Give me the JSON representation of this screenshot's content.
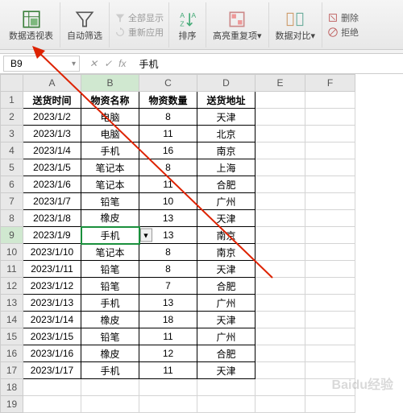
{
  "ribbon": {
    "pivot": "数据透视表",
    "autofilter": "自动筛选",
    "showall": "全部显示",
    "reapply": "重新应用",
    "sort": "排序",
    "highlight": "高亮重复项",
    "compare": "数据对比",
    "delete_prefix": "删除",
    "reject_prefix": "拒绝"
  },
  "formula_bar": {
    "name_box": "B9",
    "fx_symbol": "fx",
    "value": "手机"
  },
  "columns": [
    "A",
    "B",
    "C",
    "D",
    "E",
    "F"
  ],
  "headers": [
    "送货时间",
    "物资名称",
    "物资数量",
    "送货地址"
  ],
  "rows": [
    {
      "n": 1
    },
    {
      "n": 2,
      "a": "2023/1/2",
      "b": "电脑",
      "c": "8",
      "d": "天津"
    },
    {
      "n": 3,
      "a": "2023/1/3",
      "b": "电脑",
      "c": "11",
      "d": "北京"
    },
    {
      "n": 4,
      "a": "2023/1/4",
      "b": "手机",
      "c": "16",
      "d": "南京"
    },
    {
      "n": 5,
      "a": "2023/1/5",
      "b": "笔记本",
      "c": "8",
      "d": "上海"
    },
    {
      "n": 6,
      "a": "2023/1/6",
      "b": "笔记本",
      "c": "11",
      "d": "合肥"
    },
    {
      "n": 7,
      "a": "2023/1/7",
      "b": "铅笔",
      "c": "10",
      "d": "广州"
    },
    {
      "n": 8,
      "a": "2023/1/8",
      "b": "橡皮",
      "c": "13",
      "d": "天津"
    },
    {
      "n": 9,
      "a": "2023/1/9",
      "b": "手机",
      "c": "13",
      "d": "南京"
    },
    {
      "n": 10,
      "a": "2023/1/10",
      "b": "笔记本",
      "c": "8",
      "d": "南京"
    },
    {
      "n": 11,
      "a": "2023/1/11",
      "b": "铅笔",
      "c": "8",
      "d": "天津"
    },
    {
      "n": 12,
      "a": "2023/1/12",
      "b": "铅笔",
      "c": "7",
      "d": "合肥"
    },
    {
      "n": 13,
      "a": "2023/1/13",
      "b": "手机",
      "c": "13",
      "d": "广州"
    },
    {
      "n": 14,
      "a": "2023/1/14",
      "b": "橡皮",
      "c": "18",
      "d": "天津"
    },
    {
      "n": 15,
      "a": "2023/1/15",
      "b": "铅笔",
      "c": "11",
      "d": "广州"
    },
    {
      "n": 16,
      "a": "2023/1/16",
      "b": "橡皮",
      "c": "12",
      "d": "合肥"
    },
    {
      "n": 17,
      "a": "2023/1/17",
      "b": "手机",
      "c": "11",
      "d": "天津"
    },
    {
      "n": 18
    },
    {
      "n": 19
    }
  ],
  "selected": {
    "row": 9,
    "col": "B"
  },
  "watermark": "Baidu经验"
}
